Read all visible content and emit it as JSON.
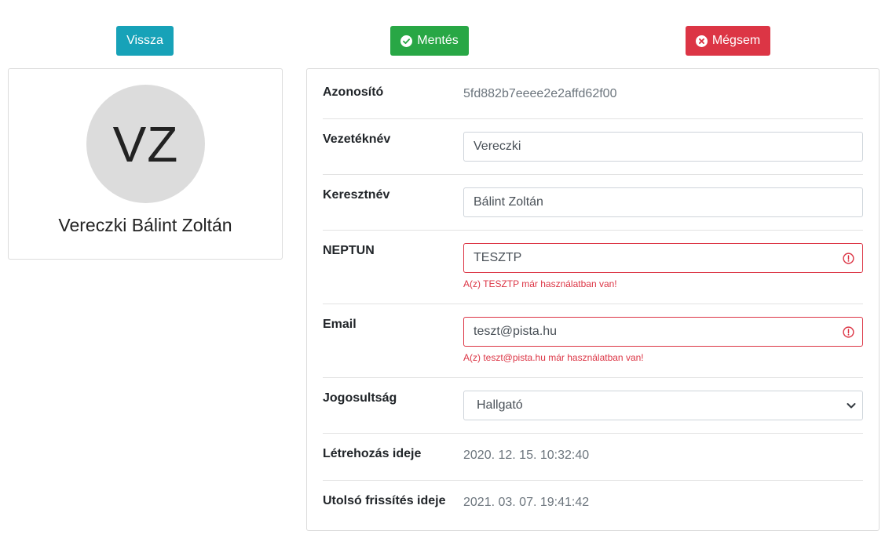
{
  "toolbar": {
    "back_label": "Vissza",
    "save_label": "Mentés",
    "cancel_label": "Mégsem"
  },
  "profile": {
    "initials": "VZ",
    "full_name": "Vereczki Bálint Zoltán"
  },
  "form": {
    "id": {
      "label": "Azonosító",
      "value": "5fd882b7eeee2e2affd62f00"
    },
    "last_name": {
      "label": "Vezetéknév",
      "value": "Vereczki"
    },
    "first_name": {
      "label": "Keresztnév",
      "value": "Bálint Zoltán"
    },
    "neptun": {
      "label": "NEPTUN",
      "value": "TESZTP",
      "error": "A(z) TESZTP már használatban van!"
    },
    "email": {
      "label": "Email",
      "value": "teszt@pista.hu",
      "error": "A(z) teszt@pista.hu már használatban van!"
    },
    "role": {
      "label": "Jogosultság",
      "selected": "Hallgató"
    },
    "created": {
      "label": "Létrehozás ideje",
      "value": "2020. 12. 15. 10:32:40"
    },
    "updated": {
      "label": "Utolsó frissítés ideje",
      "value": "2021. 03. 07. 19:41:42"
    }
  },
  "colors": {
    "info": "#17a2b8",
    "success": "#28a745",
    "danger": "#dc3545",
    "avatar_bg": "#dcdcdc"
  }
}
